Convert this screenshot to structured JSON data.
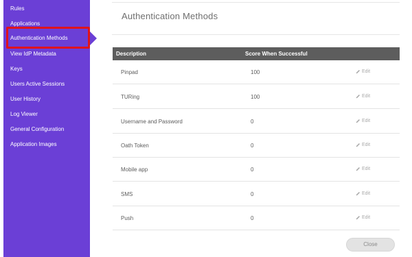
{
  "sidebar": {
    "items": [
      {
        "label": "Rules"
      },
      {
        "label": "Applications"
      },
      {
        "label": "Authentication Methods",
        "active": true
      },
      {
        "label": "View IdP Metadata"
      },
      {
        "label": "Keys"
      },
      {
        "label": "Users Active Sessions"
      },
      {
        "label": "User History"
      },
      {
        "label": "Log Viewer"
      },
      {
        "label": "General Configuration"
      },
      {
        "label": "Application Images"
      }
    ]
  },
  "main": {
    "title": "Authentication Methods",
    "table": {
      "columns": [
        "Description",
        "Score When Successful"
      ],
      "rows": [
        {
          "description": "Pinpad",
          "score": "100",
          "action": "Edit"
        },
        {
          "description": "TURing",
          "score": "100",
          "action": "Edit"
        },
        {
          "description": "Username and Password",
          "score": "0",
          "action": "Edit"
        },
        {
          "description": "Oath Token",
          "score": "0",
          "action": "Edit"
        },
        {
          "description": "Mobile app",
          "score": "0",
          "action": "Edit"
        },
        {
          "description": "SMS",
          "score": "0",
          "action": "Edit"
        },
        {
          "description": "Push",
          "score": "0",
          "action": "Edit"
        }
      ]
    },
    "close_label": "Close"
  },
  "icons": {
    "edit": "pencil-icon"
  },
  "colors": {
    "sidebar_bg": "#6b3fd6",
    "highlight_border": "#e0131b",
    "table_header_bg": "#5d5d5d"
  }
}
